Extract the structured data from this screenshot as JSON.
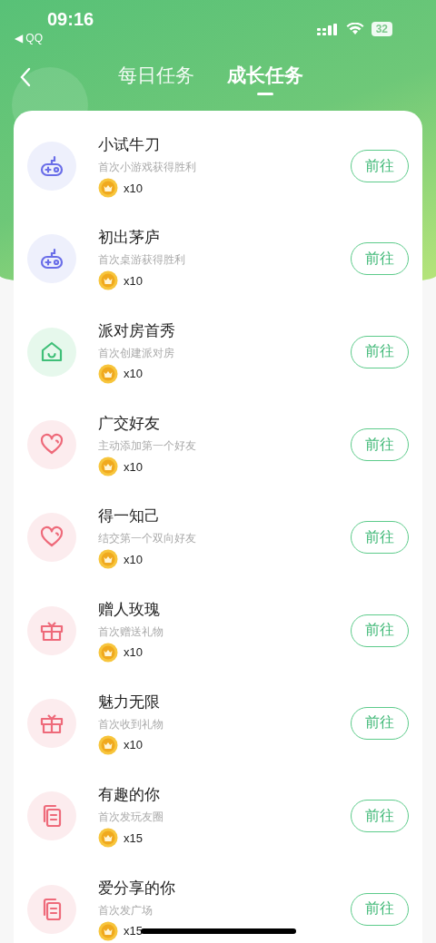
{
  "status_bar": {
    "time": "09:16",
    "back_app": "◀ QQ",
    "battery": "32"
  },
  "tabs": [
    {
      "label": "每日任务",
      "selected": false
    },
    {
      "label": "成长任务",
      "selected": true
    }
  ],
  "tasks": [
    {
      "kind": "gamepad",
      "title": "小试牛刀",
      "subtitle": "首次小游戏获得胜利",
      "reward": "x10",
      "action": "前往"
    },
    {
      "kind": "gamepad",
      "title": "初出茅庐",
      "subtitle": "首次桌游获得胜利",
      "reward": "x10",
      "action": "前往"
    },
    {
      "kind": "house",
      "title": "派对房首秀",
      "subtitle": "首次创建派对房",
      "reward": "x10",
      "action": "前往"
    },
    {
      "kind": "heart",
      "title": "广交好友",
      "subtitle": "主动添加第一个好友",
      "reward": "x10",
      "action": "前往"
    },
    {
      "kind": "heart",
      "title": "得一知己",
      "subtitle": "结交第一个双向好友",
      "reward": "x10",
      "action": "前往"
    },
    {
      "kind": "gift",
      "title": "赠人玫瑰",
      "subtitle": "首次赠送礼物",
      "reward": "x10",
      "action": "前往"
    },
    {
      "kind": "gift",
      "title": "魅力无限",
      "subtitle": "首次收到礼物",
      "reward": "x10",
      "action": "前往"
    },
    {
      "kind": "document",
      "title": "有趣的你",
      "subtitle": "首次发玩友圈",
      "reward": "x15",
      "action": "前往"
    },
    {
      "kind": "document",
      "title": "爱分享的你",
      "subtitle": "首次发广场",
      "reward": "x15",
      "action": "前往"
    }
  ]
}
